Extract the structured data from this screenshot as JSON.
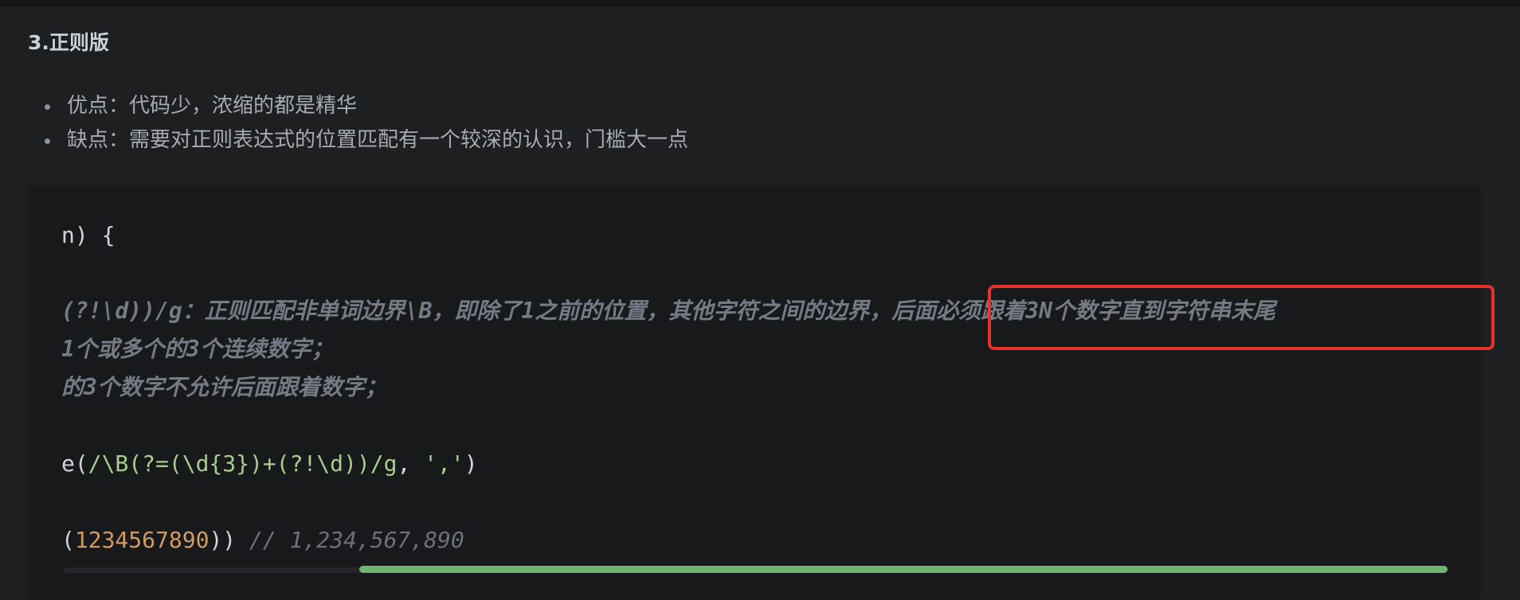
{
  "section": {
    "heading": "3.正则版"
  },
  "bullets": [
    "优点：代码少，浓缩的都是精华",
    "缺点：需要对正则表达式的位置匹配有一个较深的认识，门槛大一点"
  ],
  "code": {
    "line1": "n) {",
    "line2": "(?!\\d))/g：正则匹配非单词边界\\B，即除了1之前的位置，其他字符之间的边界，后面必须跟着3N个数字直到字符串末尾",
    "line3": "1个或多个的3个连续数字；",
    "line4": "的3个数字不允许后面跟着数字；",
    "line5": {
      "prefix": "e(",
      "regex": "/\\B(?=(\\d{3})+(?!\\d))/g",
      "sep": ", ",
      "arg": "','",
      "suffix": ")"
    },
    "line6": {
      "prefix": "(",
      "number": "1234567890",
      "suffix": ")) ",
      "comment": "// 1,234,567,890"
    }
  },
  "colors": {
    "background": "#1e1f21",
    "code_background": "#18191b",
    "highlight_border": "#e5332a",
    "scroll_thumb": "#6fb56f",
    "string_green": "#a8cc8c",
    "number_orange": "#d19a66"
  },
  "scroll": {
    "horizontal_position": 0.24
  }
}
